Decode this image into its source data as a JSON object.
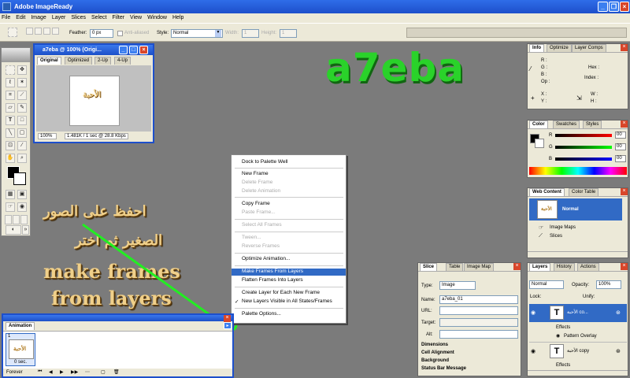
{
  "window": {
    "title": "Adobe ImageReady"
  },
  "menu": [
    "File",
    "Edit",
    "Image",
    "Layer",
    "Slices",
    "Select",
    "Filter",
    "View",
    "Window",
    "Help"
  ],
  "options_bar": {
    "feather_label": "Feather:",
    "feather_value": "0 px",
    "antialiased_label": "Anti-aliased",
    "style_label": "Style:",
    "style_value": "Normal",
    "width_label": "Width:",
    "width_value": "1",
    "height_label": "Height:",
    "height_value": "1"
  },
  "document": {
    "title": "a7eba @ 100% (Origi...",
    "tabs": [
      "Original",
      "Optimized",
      "2-Up",
      "4-Up"
    ],
    "canvas_text": "الأحبة",
    "zoom": "100%",
    "status": "1.481K / 1 sec @ 28.8 Kbps"
  },
  "overlay": {
    "brand": "a7eba",
    "line1": "احفظ على الصور",
    "line2": "الصغير ثم اختر",
    "line3": "make frames",
    "line4": "from layers"
  },
  "animation": {
    "title": "Animation",
    "frame_number": "1",
    "frame_text": "الأحبة",
    "frame_delay": "0 sec.",
    "loop": "Forever"
  },
  "context_menu": [
    {
      "label": "Dock to Palette Well",
      "state": "normal"
    },
    {
      "label": "New Frame",
      "state": "normal"
    },
    {
      "label": "Delete Frame",
      "state": "disabled"
    },
    {
      "label": "Delete Animation",
      "state": "disabled"
    },
    {
      "label": "Copy Frame",
      "state": "normal"
    },
    {
      "label": "Paste Frame...",
      "state": "disabled"
    },
    {
      "label": "Select All Frames",
      "state": "disabled"
    },
    {
      "label": "Tween...",
      "state": "disabled"
    },
    {
      "label": "Reverse Frames",
      "state": "disabled"
    },
    {
      "label": "Optimize Animation...",
      "state": "normal"
    },
    {
      "label": "Make Frames From Layers",
      "state": "highlighted"
    },
    {
      "label": "Flatten Frames Into Layers",
      "state": "normal"
    },
    {
      "label": "Create Layer for Each New Frame",
      "state": "normal"
    },
    {
      "label": "New Layers Visible in All States/Frames",
      "state": "checked"
    },
    {
      "label": "Palette Options...",
      "state": "normal"
    }
  ],
  "info_panel": {
    "tabs": [
      "Info",
      "Optimize",
      "Layer Comps"
    ],
    "r": "R :",
    "g": "G :",
    "b": "B :",
    "op": "Op :",
    "hex": "Hex :",
    "index": "Index :",
    "x": "X :",
    "y": "Y :",
    "w": "W :",
    "h": "H :"
  },
  "color_panel": {
    "tabs": [
      "Color",
      "Swatches",
      "Styles"
    ],
    "r_label": "R",
    "g_label": "G",
    "b_label": "B",
    "r_value": "00",
    "g_value": "00",
    "b_value": "00"
  },
  "web_content": {
    "tabs": [
      "Web Content",
      "Color Table"
    ],
    "item": "Normal",
    "thumb_text": "الأحبة",
    "image_maps": "Image Maps",
    "slices": "Slices"
  },
  "slice_panel": {
    "tabs": [
      "Slice",
      "Table",
      "Image Map"
    ],
    "type_label": "Type:",
    "type_value": "Image",
    "name_label": "Name:",
    "name_value": "a7eba_01",
    "url_label": "URL:",
    "target_label": "Target:",
    "alt_label": "Alt:",
    "sections": [
      "Dimensions",
      "Cell Alignment",
      "Background",
      "Status Bar Message"
    ]
  },
  "layers_panel": {
    "tabs": [
      "Layers",
      "History",
      "Actions"
    ],
    "blend": "Normal",
    "opacity_label": "Opacity:",
    "opacity": "100%",
    "lock_label": "Lock:",
    "unify_label": "Unify:",
    "layers": [
      {
        "name": "الأحبة co...",
        "effects": "Effects",
        "effect": "Pattern Overlay"
      },
      {
        "name": "الأحبة copy",
        "effects": "Effects"
      }
    ]
  }
}
